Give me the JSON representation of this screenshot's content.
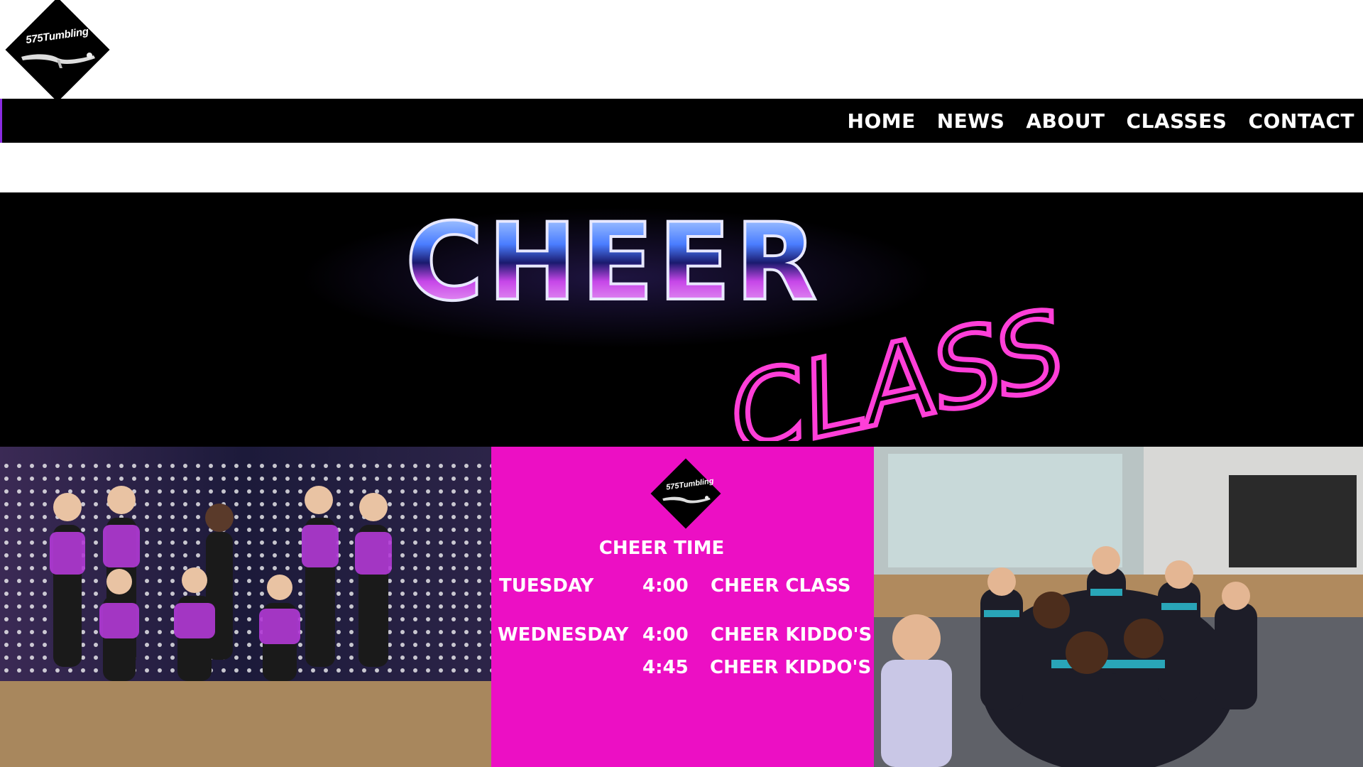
{
  "logo": {
    "text": "575Tumbling",
    "icon": "gymnast-silhouette-icon"
  },
  "nav": {
    "items": [
      "HOME",
      "NEWS",
      "ABOUT",
      "CLASSES",
      "CONTACT"
    ]
  },
  "banner": {
    "line1": "CHEER",
    "line2": "CLASS"
  },
  "schedule": {
    "logo_text": "575Tumbling",
    "title": "CHEER TIME",
    "rows": [
      {
        "day": "TUESDAY",
        "time": "4:00",
        "class": "CHEER CLASS"
      },
      {
        "day": "WEDNESDAY",
        "time": "4:00",
        "class": "CHEER KIDDO'S"
      },
      {
        "day": "",
        "time": "4:45",
        "class": "CHEER KIDDO'S"
      }
    ]
  },
  "colors": {
    "nav_bg": "#000000",
    "schedule_bg": "#ec0fc4",
    "banner_bg": "#000000",
    "accent_pink": "#ff3fd8"
  }
}
